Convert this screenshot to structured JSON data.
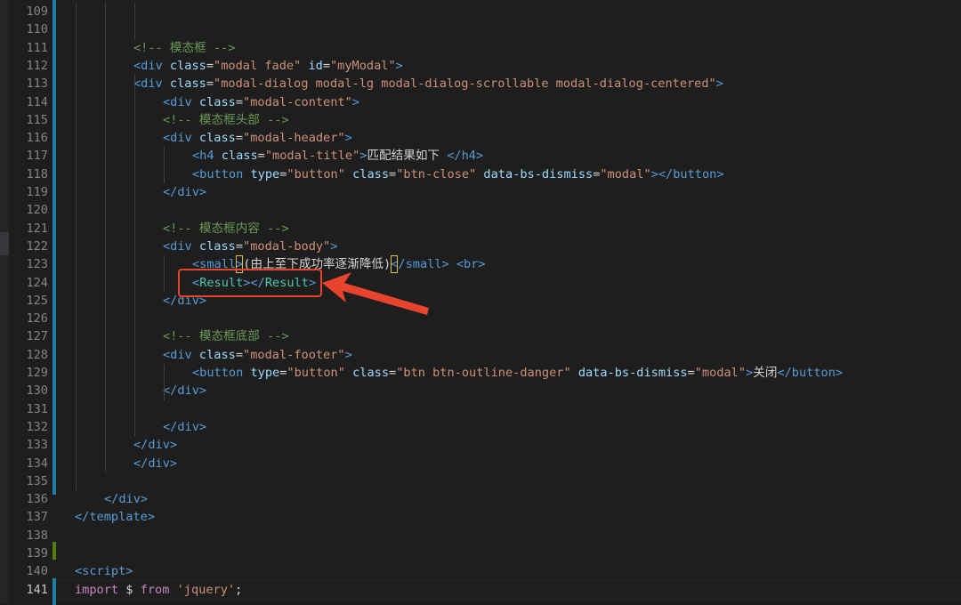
{
  "editor": {
    "active_line": "141",
    "lines": [
      {
        "n": "109",
        "indent": 0,
        "tokens": []
      },
      {
        "n": "110",
        "indent": 0,
        "tokens": []
      },
      {
        "n": "111",
        "indent": 2,
        "tokens": [
          {
            "c": "cm",
            "t": "<!-- 模态框 -->"
          }
        ]
      },
      {
        "n": "112",
        "indent": 2,
        "tokens": [
          {
            "c": "tg",
            "t": "<div "
          },
          {
            "c": "at",
            "t": "class"
          },
          {
            "c": "tx",
            "t": "="
          },
          {
            "c": "st",
            "t": "\"modal fade\""
          },
          {
            "c": "tx",
            "t": " "
          },
          {
            "c": "at",
            "t": "id"
          },
          {
            "c": "tx",
            "t": "="
          },
          {
            "c": "st",
            "t": "\"myModal\""
          },
          {
            "c": "tg",
            "t": ">"
          }
        ]
      },
      {
        "n": "113",
        "indent": 2,
        "tokens": [
          {
            "c": "tg",
            "t": "<div "
          },
          {
            "c": "at",
            "t": "class"
          },
          {
            "c": "tx",
            "t": "="
          },
          {
            "c": "st",
            "t": "\"modal-dialog modal-lg modal-dialog-scrollable modal-dialog-centered\""
          },
          {
            "c": "tg",
            "t": ">"
          }
        ]
      },
      {
        "n": "114",
        "indent": 3,
        "tokens": [
          {
            "c": "tg",
            "t": "<div "
          },
          {
            "c": "at",
            "t": "class"
          },
          {
            "c": "tx",
            "t": "="
          },
          {
            "c": "st",
            "t": "\"modal-content\""
          },
          {
            "c": "tg",
            "t": ">"
          }
        ]
      },
      {
        "n": "115",
        "indent": 3,
        "tokens": [
          {
            "c": "cm",
            "t": "<!-- 模态框头部 -->"
          }
        ]
      },
      {
        "n": "116",
        "indent": 3,
        "tokens": [
          {
            "c": "tg",
            "t": "<div "
          },
          {
            "c": "at",
            "t": "class"
          },
          {
            "c": "tx",
            "t": "="
          },
          {
            "c": "st",
            "t": "\"modal-header\""
          },
          {
            "c": "tg",
            "t": ">"
          }
        ]
      },
      {
        "n": "117",
        "indent": 4,
        "tokens": [
          {
            "c": "tg",
            "t": "<h4 "
          },
          {
            "c": "at",
            "t": "class"
          },
          {
            "c": "tx",
            "t": "="
          },
          {
            "c": "st",
            "t": "\"modal-title\""
          },
          {
            "c": "tg",
            "t": ">"
          },
          {
            "c": "tx",
            "t": "匹配结果如下 "
          },
          {
            "c": "tg",
            "t": "</h4>"
          }
        ]
      },
      {
        "n": "118",
        "indent": 4,
        "tokens": [
          {
            "c": "tg",
            "t": "<button "
          },
          {
            "c": "at",
            "t": "type"
          },
          {
            "c": "tx",
            "t": "="
          },
          {
            "c": "st",
            "t": "\"button\""
          },
          {
            "c": "tx",
            "t": " "
          },
          {
            "c": "at",
            "t": "class"
          },
          {
            "c": "tx",
            "t": "="
          },
          {
            "c": "st",
            "t": "\"btn-close\""
          },
          {
            "c": "tx",
            "t": " "
          },
          {
            "c": "at",
            "t": "data-bs-dismiss"
          },
          {
            "c": "tx",
            "t": "="
          },
          {
            "c": "st",
            "t": "\"modal\""
          },
          {
            "c": "tg",
            "t": "></button>"
          }
        ]
      },
      {
        "n": "119",
        "indent": 3,
        "tokens": [
          {
            "c": "tg",
            "t": "</div>"
          }
        ]
      },
      {
        "n": "120",
        "indent": 0,
        "tokens": []
      },
      {
        "n": "121",
        "indent": 3,
        "tokens": [
          {
            "c": "cm",
            "t": "<!-- 模态框内容 -->"
          }
        ]
      },
      {
        "n": "122",
        "indent": 3,
        "tokens": [
          {
            "c": "tg",
            "t": "<div "
          },
          {
            "c": "at",
            "t": "class"
          },
          {
            "c": "tx",
            "t": "="
          },
          {
            "c": "st",
            "t": "\"modal-body\""
          },
          {
            "c": "tg",
            "t": ">"
          }
        ]
      },
      {
        "n": "123",
        "indent": 4,
        "tokens": [
          {
            "c": "tg",
            "t": "<small"
          },
          {
            "c": "tg bracket-box",
            "t": ">"
          },
          {
            "c": "tx",
            "t": "(由上至下成功率逐渐降低)"
          },
          {
            "c": "tg bracket-box",
            "t": "<"
          },
          {
            "c": "tg",
            "t": "/small>"
          },
          {
            "c": "tx",
            "t": " "
          },
          {
            "c": "tg",
            "t": "<br>"
          }
        ]
      },
      {
        "n": "124",
        "indent": 4,
        "tokens": [
          {
            "c": "tg",
            "t": "<"
          },
          {
            "c": "cp",
            "t": "Result"
          },
          {
            "c": "tg",
            "t": "></"
          },
          {
            "c": "cp",
            "t": "Result"
          },
          {
            "c": "tg",
            "t": ">"
          }
        ]
      },
      {
        "n": "125",
        "indent": 3,
        "tokens": [
          {
            "c": "tg",
            "t": "</div>"
          }
        ]
      },
      {
        "n": "126",
        "indent": 0,
        "tokens": []
      },
      {
        "n": "127",
        "indent": 3,
        "tokens": [
          {
            "c": "cm",
            "t": "<!-- 模态框底部 -->"
          }
        ]
      },
      {
        "n": "128",
        "indent": 3,
        "tokens": [
          {
            "c": "tg",
            "t": "<div "
          },
          {
            "c": "at",
            "t": "class"
          },
          {
            "c": "tx",
            "t": "="
          },
          {
            "c": "st",
            "t": "\"modal-footer\""
          },
          {
            "c": "tg",
            "t": ">"
          }
        ]
      },
      {
        "n": "129",
        "indent": 4,
        "tokens": [
          {
            "c": "tg",
            "t": "<button "
          },
          {
            "c": "at",
            "t": "type"
          },
          {
            "c": "tx",
            "t": "="
          },
          {
            "c": "st",
            "t": "\"button\""
          },
          {
            "c": "tx",
            "t": " "
          },
          {
            "c": "at",
            "t": "class"
          },
          {
            "c": "tx",
            "t": "="
          },
          {
            "c": "st",
            "t": "\"btn btn-outline-danger\""
          },
          {
            "c": "tx",
            "t": " "
          },
          {
            "c": "at",
            "t": "data-bs-dismiss"
          },
          {
            "c": "tx",
            "t": "="
          },
          {
            "c": "st",
            "t": "\"modal\""
          },
          {
            "c": "tg",
            "t": ">"
          },
          {
            "c": "tx",
            "t": "关闭"
          },
          {
            "c": "tg",
            "t": "</button>"
          }
        ]
      },
      {
        "n": "130",
        "indent": 3,
        "tokens": [
          {
            "c": "tg",
            "t": "</div>"
          }
        ]
      },
      {
        "n": "131",
        "indent": 0,
        "tokens": []
      },
      {
        "n": "132",
        "indent": 3,
        "tokens": [
          {
            "c": "tg",
            "t": "</div>"
          }
        ]
      },
      {
        "n": "133",
        "indent": 2,
        "tokens": [
          {
            "c": "tg",
            "t": "</div>"
          }
        ]
      },
      {
        "n": "134",
        "indent": 2,
        "tokens": [
          {
            "c": "tg",
            "t": "</div>"
          }
        ]
      },
      {
        "n": "135",
        "indent": 0,
        "tokens": []
      },
      {
        "n": "136",
        "indent": 1,
        "tokens": [
          {
            "c": "tg",
            "t": "</div>"
          }
        ]
      },
      {
        "n": "137",
        "indent": 0,
        "tokens": [
          {
            "c": "tg",
            "t": "</template>"
          }
        ]
      },
      {
        "n": "138",
        "indent": 0,
        "tokens": []
      },
      {
        "n": "139",
        "indent": 0,
        "tokens": []
      },
      {
        "n": "140",
        "indent": 0,
        "tokens": [
          {
            "c": "tg",
            "t": "<script>"
          }
        ]
      },
      {
        "n": "141",
        "indent": 0,
        "tokens": [
          {
            "c": "kw",
            "t": "import"
          },
          {
            "c": "tx",
            "t": " $ "
          },
          {
            "c": "kw",
            "t": "from"
          },
          {
            "c": "tx",
            "t": " "
          },
          {
            "c": "st",
            "t": "'jquery'"
          },
          {
            "c": "tx",
            "t": ";"
          }
        ]
      }
    ]
  },
  "colors": {
    "background": "#1e1e1e",
    "comment": "#6a9955",
    "tag": "#569cd6",
    "attribute": "#9cdcfe",
    "string": "#ce9178",
    "component": "#4ec9b0",
    "keyword": "#c586c0",
    "annotation": "#e8432d"
  },
  "annotation": {
    "icon": "red-arrow-icon"
  }
}
